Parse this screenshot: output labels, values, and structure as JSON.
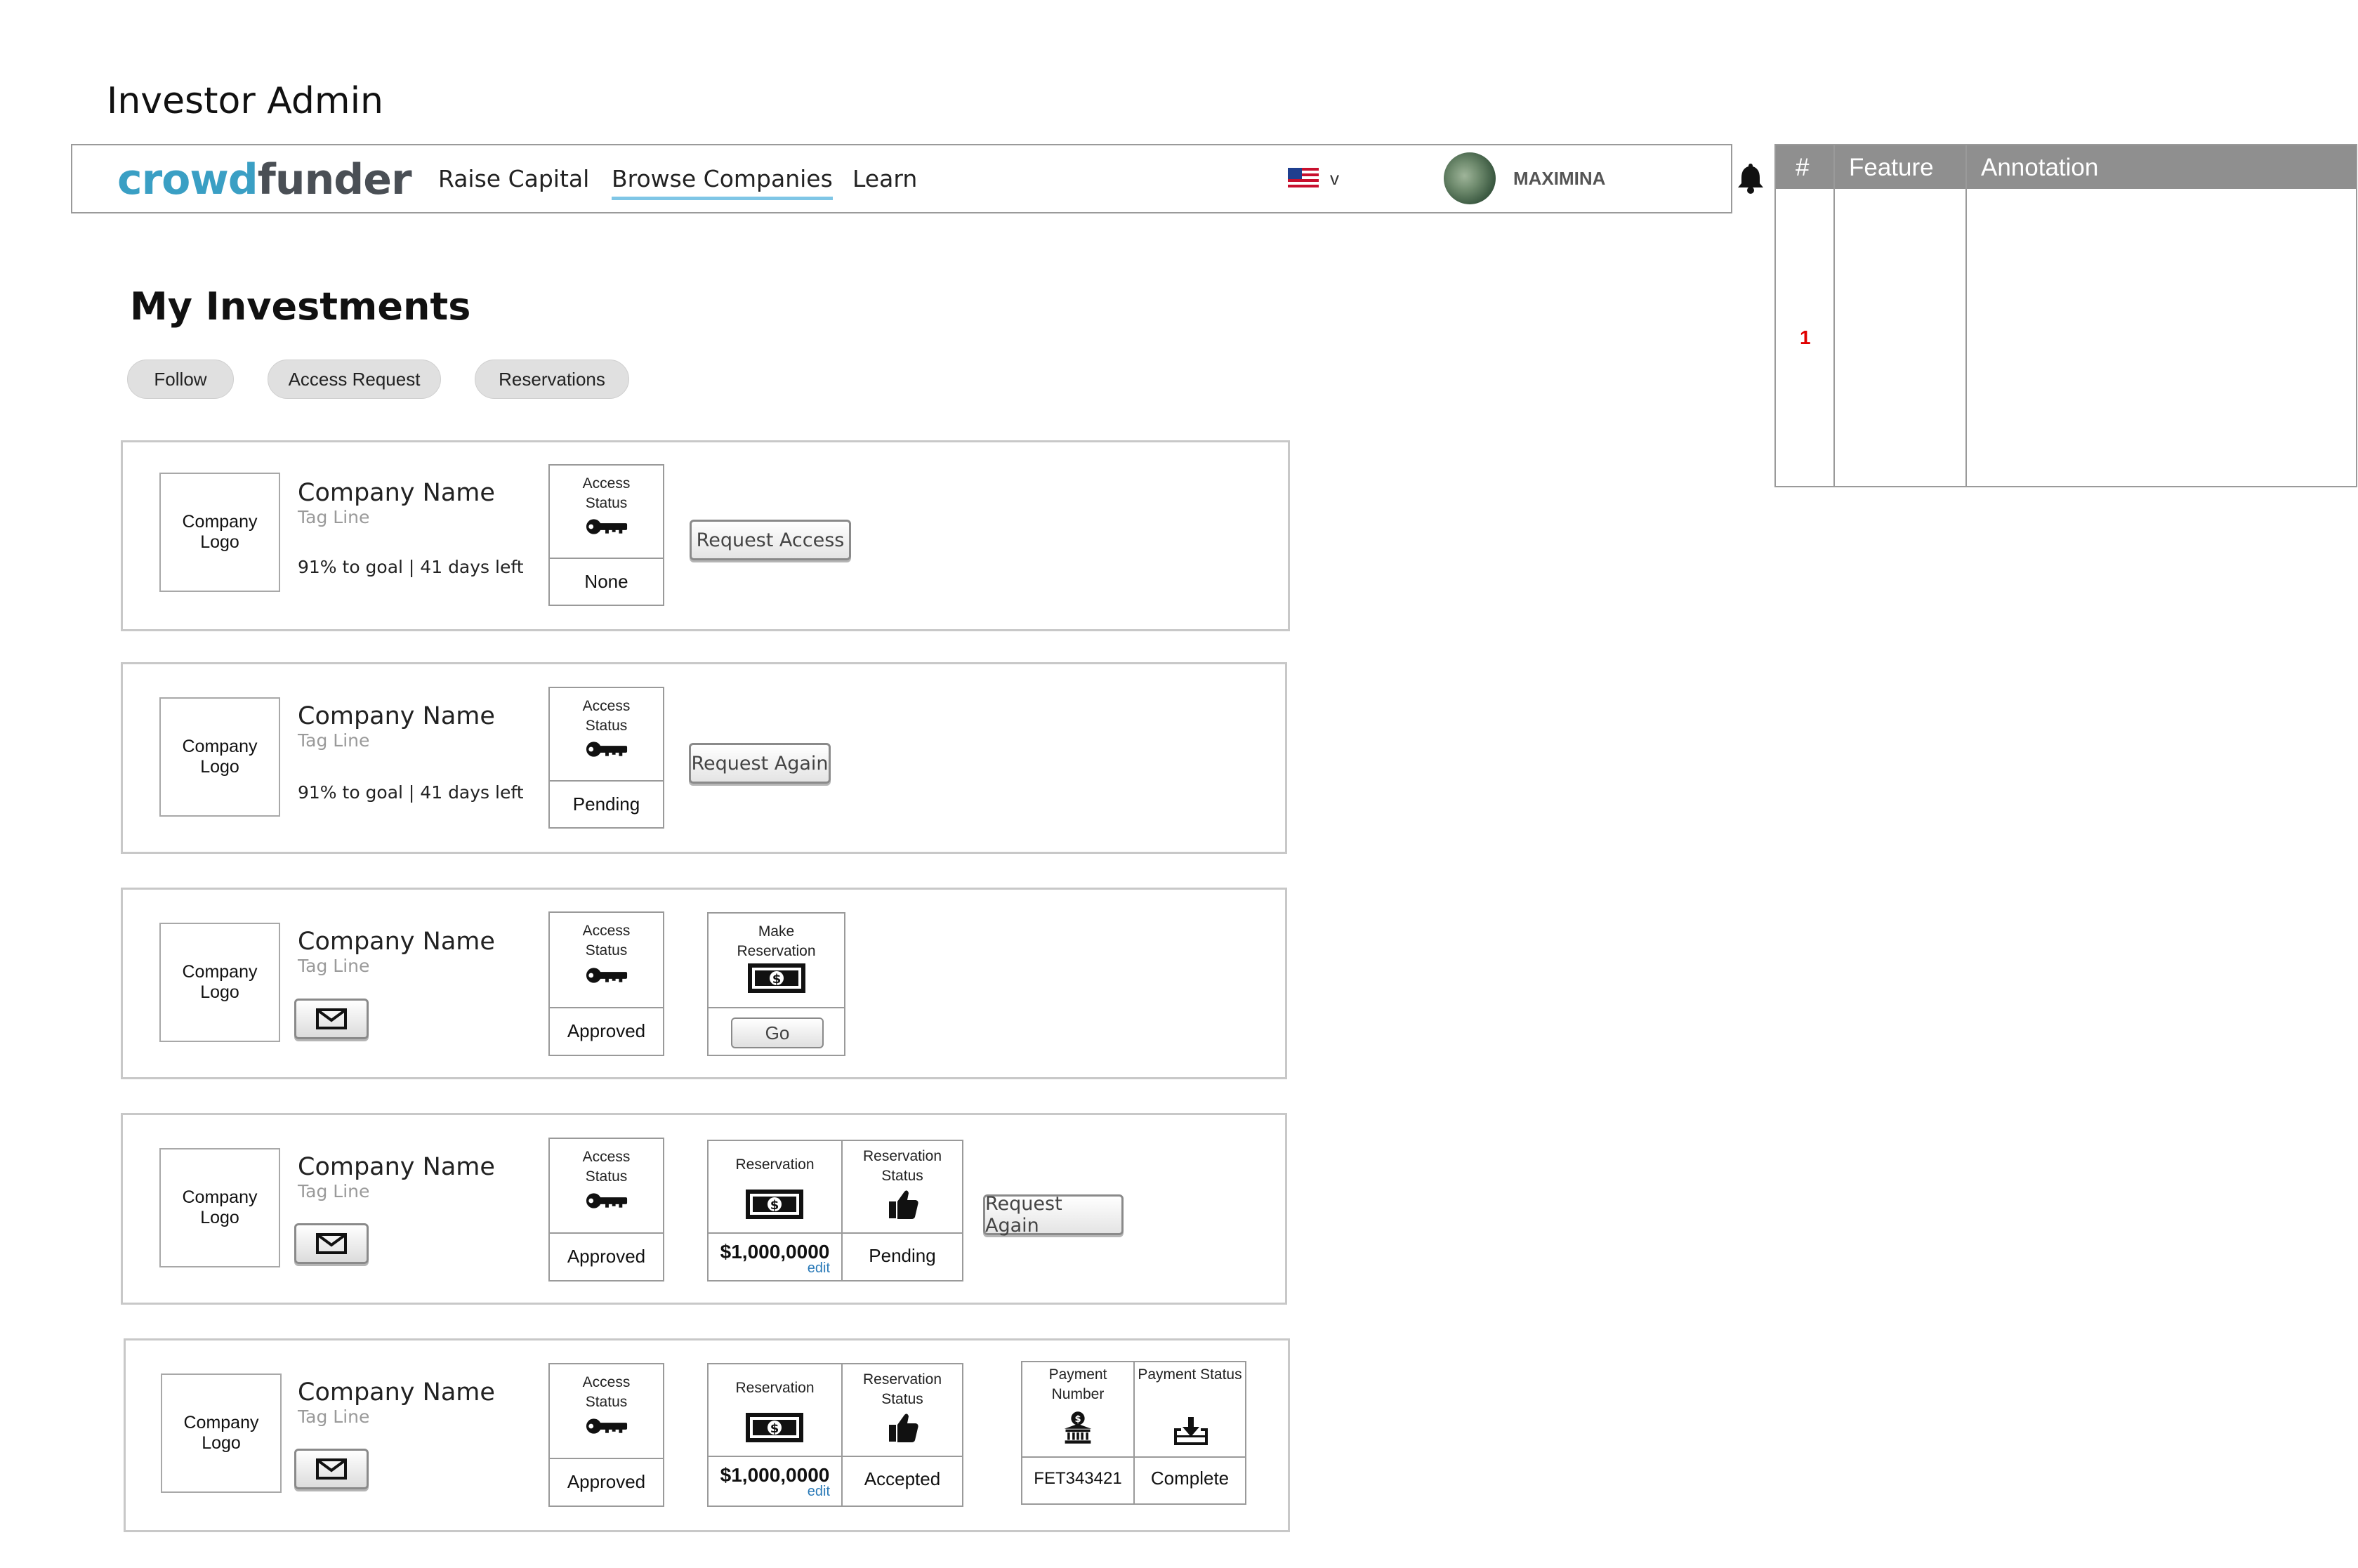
{
  "page_title": "Investor Admin",
  "nav": {
    "logo_part1": "crowd",
    "logo_part2": "funder",
    "links": [
      "Raise Capital",
      "Browse Companies",
      "Learn"
    ],
    "active_link": "Browse Companies",
    "language_caret": "v",
    "username": "MAXIMINA"
  },
  "section_title": "My Investments",
  "filters": [
    "Follow",
    "Access Request",
    "Reservations"
  ],
  "cards": [
    {
      "logo": "Company Logo",
      "name": "Company Name",
      "tagline": "Tag Line",
      "progress": "91% to goal | 41 days left",
      "access_label": "Access Status",
      "access_value": "None",
      "action": "Request Access"
    },
    {
      "logo": "Company Logo",
      "name": "Company Name",
      "tagline": "Tag Line",
      "progress": "91% to goal | 41 days left",
      "access_label": "Access Status",
      "access_value": "Pending",
      "action": "Request Again"
    },
    {
      "logo": "Company Logo",
      "name": "Company Name",
      "tagline": "Tag Line",
      "access_label": "Access Status",
      "access_value": "Approved",
      "make_reservation_label": "Make Reservation",
      "go_label": "Go"
    },
    {
      "logo": "Company Logo",
      "name": "Company Name",
      "tagline": "Tag Line",
      "access_label": "Access Status",
      "access_value": "Approved",
      "reservation_label": "Reservation",
      "reservation_amount": "$1,000,0000",
      "edit_label": "edit",
      "reservation_status_label": "Reservation Status",
      "reservation_status": "Pending",
      "action": "Request Again"
    },
    {
      "logo": "Company Logo",
      "name": "Company Name",
      "tagline": "Tag Line",
      "access_label": "Access Status",
      "access_value": "Approved",
      "reservation_label": "Reservation",
      "reservation_amount": "$1,000,0000",
      "edit_label": "edit",
      "reservation_status_label": "Reservation Status",
      "reservation_status": "Accepted",
      "payment_number_label": "Payment Number",
      "payment_number": "FET343421",
      "payment_status_label": "Payment Status",
      "payment_status": "Complete"
    }
  ],
  "annotation": {
    "headers": [
      "#",
      "Feature",
      "Annotation"
    ],
    "rows": [
      {
        "num": "1",
        "feature": "",
        "annotation": ""
      }
    ]
  },
  "icons": {
    "key": "key-icon",
    "money": "money-bill-icon",
    "thumb": "thumbs-up-icon",
    "bank": "bank-icon",
    "inbox": "inbox-download-icon",
    "mail": "envelope-icon",
    "bell": "bell-icon",
    "flag": "us-flag-icon"
  },
  "colors": {
    "brand_blue": "#3a9fc4",
    "brand_gray": "#4a4f55",
    "nav_underline": "#7fc6e6",
    "annotation_number": "#e00000"
  }
}
